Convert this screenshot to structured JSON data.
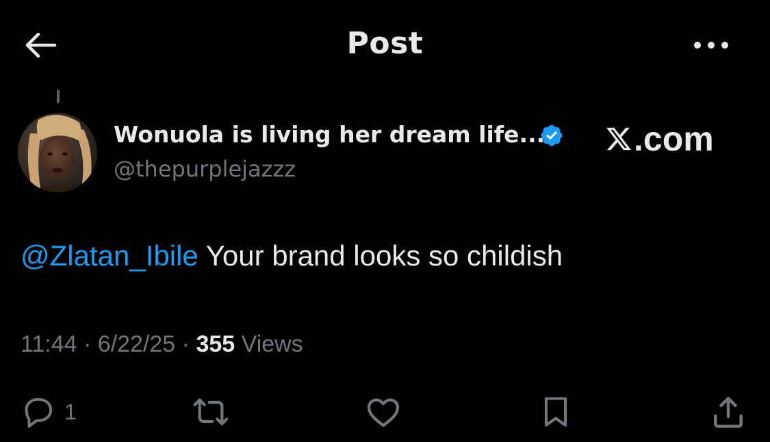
{
  "header": {
    "title": "Post",
    "back_icon": "arrow-left-icon",
    "more_icon": "ellipsis-icon"
  },
  "author": {
    "display_name": "Wonuola is living her dream life...",
    "handle": "@thepurplejazzz",
    "verified": true,
    "verified_color": "#1d9bf0"
  },
  "watermark": {
    "text": ".com",
    "logo": "x-logo-icon"
  },
  "tweet": {
    "mention": "@Zlatan_Ibile",
    "text": " Your brand looks so childish",
    "mention_color": "#1d9bf0"
  },
  "meta": {
    "time": "11:44",
    "separator": " · ",
    "date": "6/22/25",
    "views_count": "355",
    "views_label": " Views"
  },
  "actions": {
    "reply_count": "1",
    "reply_icon": "reply-icon",
    "repost_icon": "repost-icon",
    "like_icon": "heart-icon",
    "bookmark_icon": "bookmark-icon",
    "share_icon": "share-icon"
  },
  "colors": {
    "background": "#000000",
    "primary_text": "#e7e9ea",
    "secondary_text": "#71767b",
    "accent": "#1d9bf0"
  }
}
